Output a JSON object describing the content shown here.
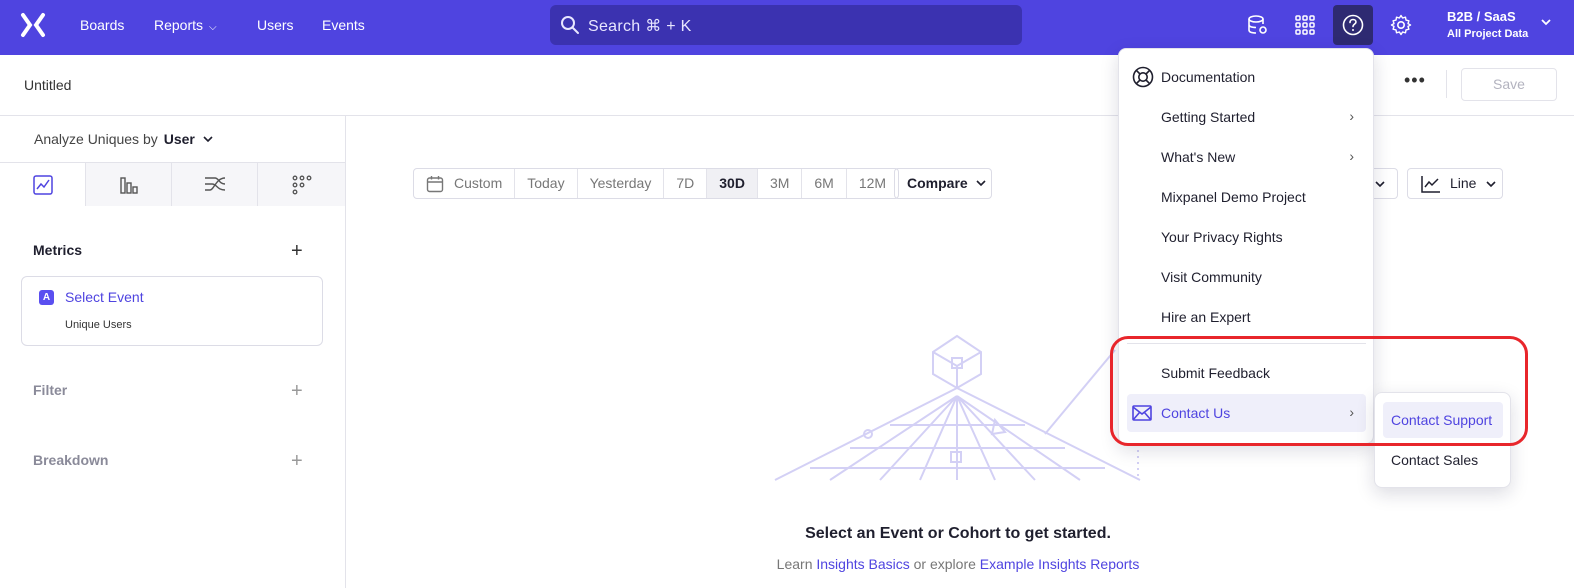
{
  "nav": {
    "items": [
      {
        "label": "Boards",
        "has_dropdown": false
      },
      {
        "label": "Reports",
        "has_dropdown": true
      },
      {
        "label": "Users",
        "has_dropdown": false
      },
      {
        "label": "Events",
        "has_dropdown": false
      }
    ],
    "search_placeholder": "Search ⌘ + K",
    "icons": [
      "database-settings-icon",
      "apps-grid-icon",
      "help-icon",
      "settings-gear-icon"
    ],
    "project": {
      "name": "B2B / SaaS",
      "scope": "All Project Data"
    },
    "accent_color": "#4f44e0"
  },
  "report": {
    "title": "Untitled",
    "more_label": "•••",
    "save_label": "Save"
  },
  "left_panel": {
    "analyze_prefix": "Analyze Uniques by",
    "analyze_value": "User",
    "tabs": [
      "insights-chart-icon",
      "funnels-bars-icon",
      "flows-icon",
      "retention-dots-icon"
    ],
    "metrics_label": "Metrics",
    "metric": {
      "badge": "A",
      "event": "Select Event",
      "measure": "Unique Users"
    },
    "filter_label": "Filter",
    "breakdown_label": "Breakdown"
  },
  "toolbar": {
    "date_ranges": [
      "Custom",
      "Today",
      "Yesterday",
      "7D",
      "30D",
      "3M",
      "6M",
      "12M"
    ],
    "active_range": "30D",
    "compare_label": "Compare",
    "chart_type_label": "Line"
  },
  "empty_state": {
    "title": "Select an Event or Cohort to get started.",
    "learn_prefix": "Learn",
    "link1": "Insights Basics",
    "middle": "or explore",
    "link2": "Example Insights Reports"
  },
  "help_menu": {
    "items": [
      {
        "label": "Documentation",
        "icon": "lifebuoy-icon",
        "has_submenu": false
      },
      {
        "label": "Getting Started",
        "has_submenu": true
      },
      {
        "label": "What's New",
        "has_submenu": true
      },
      {
        "label": "Mixpanel Demo Project",
        "has_submenu": false
      },
      {
        "label": "Your Privacy Rights",
        "has_submenu": false
      },
      {
        "label": "Visit Community",
        "has_submenu": false
      },
      {
        "label": "Hire an Expert",
        "has_submenu": false
      },
      {
        "label": "Submit Feedback",
        "has_submenu": false
      },
      {
        "label": "Contact Us",
        "icon": "envelope-icon",
        "has_submenu": true,
        "highlighted": true
      }
    ],
    "submenu": [
      "Contact Support",
      "Contact Sales"
    ],
    "highlighted_submenu_item": "Contact Support"
  }
}
